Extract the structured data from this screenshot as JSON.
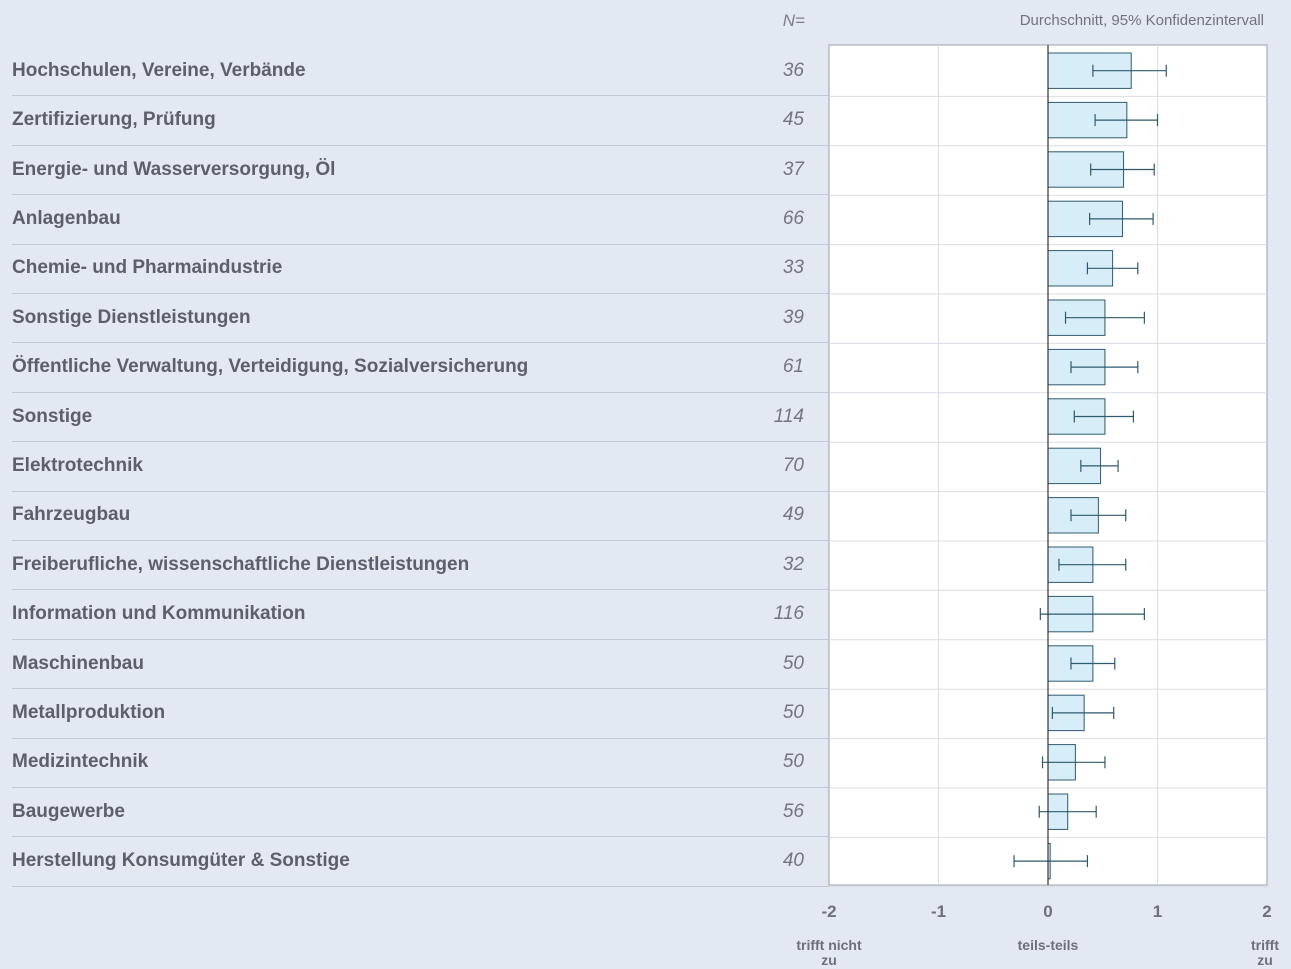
{
  "header": {
    "n_label": "N=",
    "legend": "Durchschnitt, 95% Konfidenzintervall"
  },
  "colors": {
    "bar_fill": "#d7eef8",
    "bar_stroke": "#2e5a6e",
    "grid": "#d9dde3",
    "axis": "#333333",
    "background": "#e3e9f2"
  },
  "chart_data": {
    "type": "bar",
    "orientation": "horizontal",
    "error_bars": "95% confidence interval",
    "xlim": [
      -2,
      2
    ],
    "xticks": [
      -2,
      -1,
      0,
      1,
      2
    ],
    "xtick_labels": [
      "-2",
      "-1",
      "0",
      "1",
      "2"
    ],
    "scale_labels": [
      {
        "at": -2,
        "text": "trifft nicht zu"
      },
      {
        "at": 0,
        "text": "teils-teils"
      },
      {
        "at": 2,
        "text": "trifft zu"
      }
    ],
    "grid": true,
    "categories": [
      "Hochschulen, Vereine, Verbände",
      "Zertifizierung, Prüfung",
      "Energie- und Wasserversorgung, Öl",
      "Anlagenbau",
      "Chemie- und Pharmaindustrie",
      "Sonstige Dienstleistungen",
      "Öffentliche Verwaltung, Verteidigung, Sozialversicherung",
      "Sonstige",
      "Elektrotechnik",
      "Fahrzeugbau",
      "Freiberufliche, wissenschaftliche Dienstleistungen",
      "Information und Kommunikation",
      "Maschinenbau",
      "Metallproduktion",
      "Medizintechnik",
      "Baugewerbe",
      "Herstellung Konsumgüter & Sonstige"
    ],
    "n": [
      "36",
      "45",
      "37",
      "66",
      "33",
      "39",
      "61",
      "114",
      "70",
      "49",
      "32",
      "116",
      "50",
      "50",
      "50",
      "56",
      "40"
    ],
    "values": [
      0.76,
      0.72,
      0.69,
      0.68,
      0.59,
      0.52,
      0.52,
      0.52,
      0.48,
      0.46,
      0.41,
      0.41,
      0.41,
      0.33,
      0.25,
      0.18,
      0.02
    ],
    "ci_low": [
      0.41,
      0.43,
      0.39,
      0.38,
      0.36,
      0.16,
      0.21,
      0.24,
      0.3,
      0.21,
      0.1,
      -0.07,
      0.21,
      0.04,
      -0.05,
      -0.08,
      -0.31
    ],
    "ci_high": [
      1.08,
      1.0,
      0.97,
      0.96,
      0.82,
      0.88,
      0.82,
      0.78,
      0.64,
      0.71,
      0.71,
      0.88,
      0.61,
      0.6,
      0.52,
      0.44,
      0.36
    ]
  }
}
